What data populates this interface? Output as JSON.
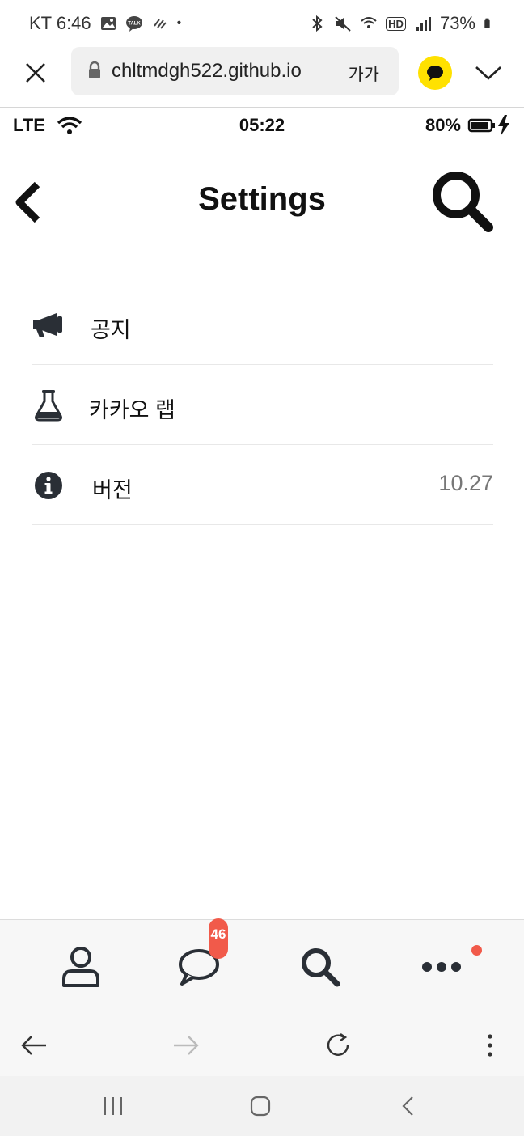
{
  "system_status": {
    "carrier_time": "KT 6:46",
    "battery": "73%",
    "hd_label": "HD"
  },
  "browser": {
    "url": "chltmdgh522.github.io",
    "text_size_label": "가가"
  },
  "app_status": {
    "network": "LTE",
    "time": "05:22",
    "battery": "80%"
  },
  "header": {
    "title": "Settings"
  },
  "settings_items": [
    {
      "label": "공지",
      "icon": "megaphone-icon",
      "value": ""
    },
    {
      "label": "카카오 랩",
      "icon": "flask-icon",
      "value": ""
    },
    {
      "label": "버전",
      "icon": "info-icon",
      "value": "10.27"
    }
  ],
  "tabbar": {
    "chat_badge": "46",
    "tabs": [
      "friends-icon",
      "chat-icon",
      "search-icon",
      "more-icon"
    ]
  },
  "colors": {
    "accent_badge": "#f15a4a",
    "kakao_yellow": "#ffe100",
    "icon_dark": "#2a2f36"
  }
}
